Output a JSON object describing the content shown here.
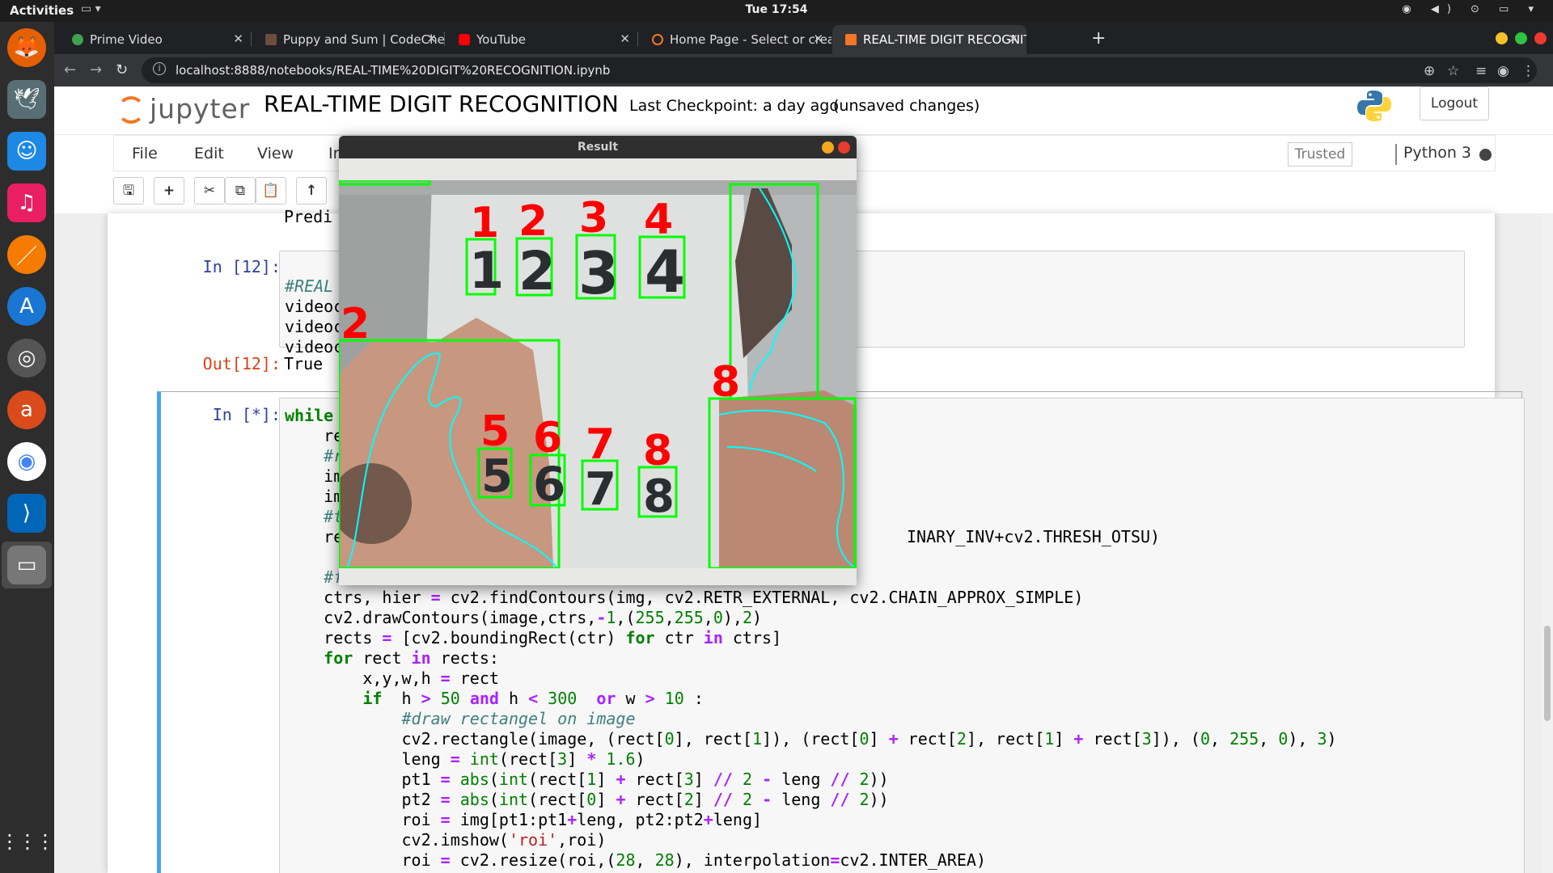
{
  "topbar": {
    "activities": "Activities",
    "clock": "Tue 17:54"
  },
  "browser": {
    "tabs": [
      {
        "title": "Prime Video",
        "favicon_color": "#3fa34d"
      },
      {
        "title": "Puppy and Sum | CodeChef",
        "favicon_color": "#6d4c41"
      },
      {
        "title": "YouTube",
        "favicon_color": "#ff0000"
      },
      {
        "title": "Home Page - Select or create",
        "favicon_color": "#f37726"
      },
      {
        "title": "REAL-TIME DIGIT RECOGNITION",
        "favicon_color": "#f37726"
      }
    ],
    "url": "localhost:8888/notebooks/REAL-TIME%20DIGIT%20RECOGNITION.ipynb"
  },
  "jupyter": {
    "logo_text": "jupyter",
    "notebook_title": "REAL-TIME DIGIT RECOGNITION",
    "checkpoint": "Last Checkpoint: a day ago",
    "unsaved": "(unsaved changes)",
    "logout": "Logout",
    "menus": [
      "File",
      "Edit",
      "View",
      "Insert"
    ],
    "trusted": "Trusted",
    "kernel": "Python 3"
  },
  "cells": {
    "prev_output": "Predi",
    "cell12_prompt": "In [12]:",
    "cell12_lines": [
      "#REAL",
      "videoc",
      "videoc",
      "videoc"
    ],
    "out12_prompt": "Out[12]:",
    "out12_value": "True",
    "active_prompt": "In [*]:",
    "partial_line": "INARY_INV+cv2.THRESH_OTSU)"
  },
  "result_window": {
    "title": "Result",
    "labels": [
      {
        "text": "1"
      },
      {
        "text": "2"
      },
      {
        "text": "3"
      },
      {
        "text": "4"
      },
      {
        "text": "5"
      },
      {
        "text": "6"
      },
      {
        "text": "7"
      },
      {
        "text": "8"
      },
      {
        "text": "2"
      },
      {
        "text": "8"
      }
    ],
    "digits": [
      "1",
      "2",
      "3",
      "4",
      "5",
      "6",
      "7",
      "8"
    ],
    "box_color": "#00ff00",
    "contour_color": "#00ffff",
    "label_color": "#ff0000"
  }
}
